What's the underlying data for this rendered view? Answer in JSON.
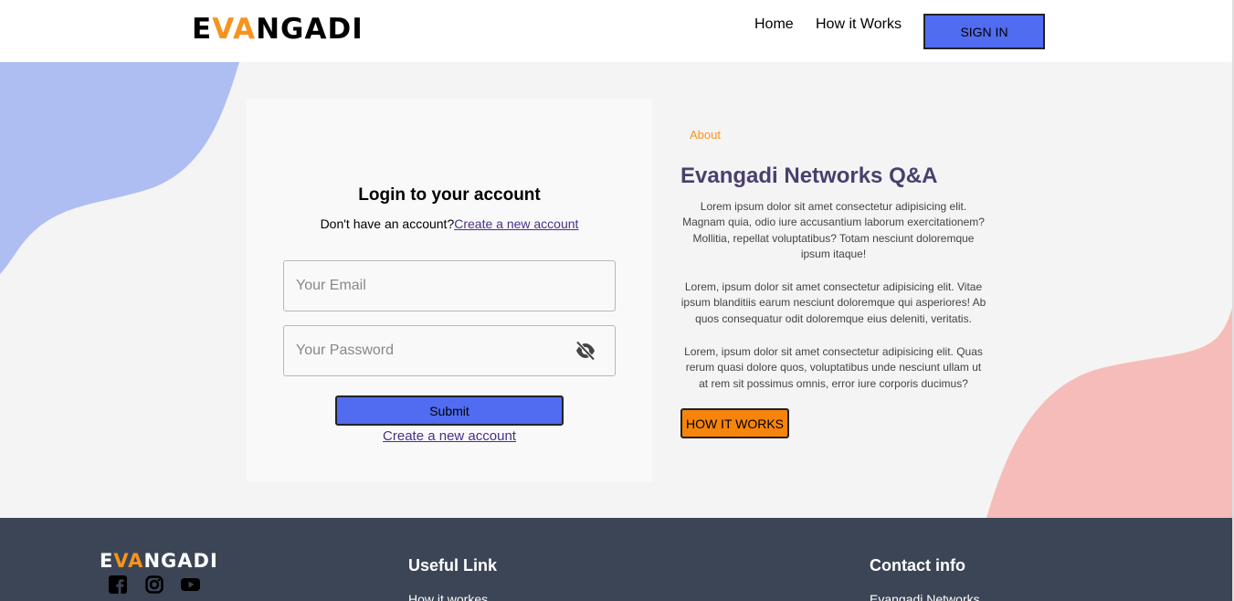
{
  "header": {
    "logo": {
      "part1": "E",
      "part2": "VA",
      "part3": "NGADI"
    },
    "nav": [
      "Home",
      "How it Works"
    ],
    "sign_in": "SIGN IN"
  },
  "login": {
    "title": "Login to your account",
    "prompt": "Don't have an account?",
    "create_link": "Create a new account",
    "email_placeholder": "Your Email",
    "password_placeholder": "Your Password",
    "submit": "Submit",
    "create_link_bottom": "Create a new account"
  },
  "about": {
    "label": "About",
    "title": "Evangadi Networks Q&A",
    "paragraphs": [
      "Lorem ipsum dolor sit amet consectetur adipisicing elit. Magnam quia, odio iure accusantium laborum exercitationem? Mollitia, repellat voluptatibus? Totam nesciunt doloremque ipsum itaque!",
      "Lorem, ipsum dolor sit amet consectetur adipisicing elit. Vitae ipsum blanditiis earum nesciunt doloremque qui asperiores! Ab quos consequatur odit doloremque eius deleniti, veritatis.",
      "Lorem, ipsum dolor sit amet consectetur adipisicing elit. Quas rerum quasi dolore quos, voluptatibus unde nesciunt ullam ut at rem sit possimus omnis, error iure corporis ducimus?"
    ],
    "button": "HOW IT WORKS"
  },
  "footer": {
    "logo": {
      "part1": "E",
      "part2": "VA",
      "part3": "NGADI"
    },
    "social_icons": [
      "facebook-icon",
      "instagram-icon",
      "youtube-icon"
    ],
    "useful_heading": "Useful Link",
    "useful_link": "How it workes",
    "contact_heading": "Contact info",
    "contact_line": "Evangadi Networks"
  },
  "colors": {
    "accent_blue": "#516cf0",
    "accent_orange": "#f7931e",
    "footer_bg": "#3b4556",
    "blob_blue": "#aebef3",
    "blob_pink": "#f6bcb9"
  }
}
